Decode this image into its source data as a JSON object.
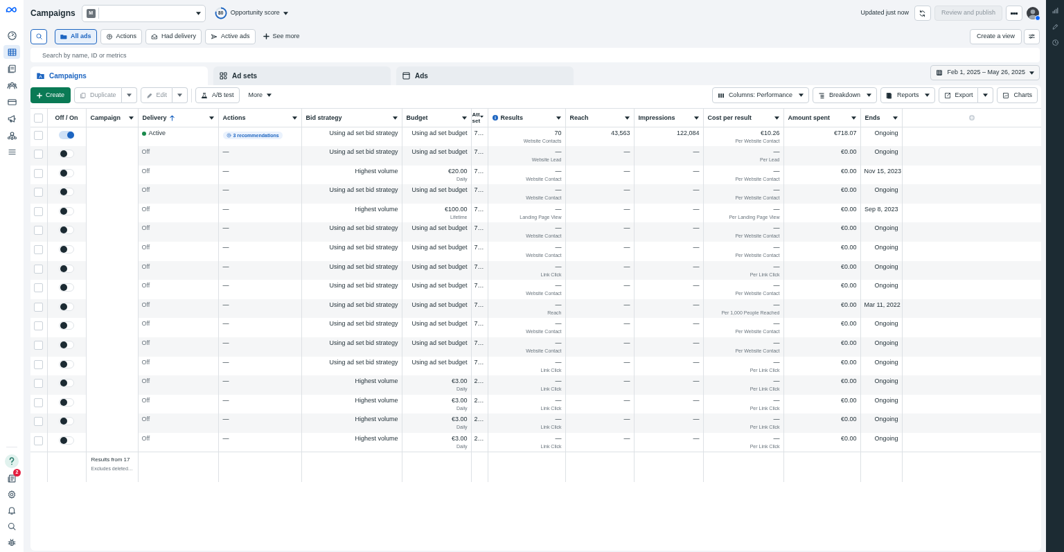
{
  "top_bar": {
    "title": "Campaigns",
    "account": {
      "initial": "M"
    },
    "opportunity": {
      "score": "80",
      "label": "Opportunity score"
    },
    "updated": "Updated just now",
    "publish_button": {
      "label": "Review and publish",
      "disabled": true
    }
  },
  "sidebar": {
    "items": [
      {
        "selected": false
      },
      {
        "selected": true
      },
      {
        "selected": false
      },
      {
        "selected": false
      },
      {
        "selected": false
      },
      {
        "selected": false
      },
      {
        "selected": false
      },
      {
        "selected": false
      }
    ],
    "notification_badge": "2"
  },
  "filters": [
    {
      "label": "All ads",
      "selected": true
    },
    {
      "label": "Actions",
      "selected": false
    },
    {
      "label": "Had delivery",
      "selected": false
    },
    {
      "label": "Active ads",
      "selected": false
    }
  ],
  "see_more": "See more",
  "create_view": "Create a view",
  "search": {
    "placeholder": "Search by name, ID or metrics"
  },
  "tabs": [
    {
      "label": "Campaigns",
      "selected": true
    },
    {
      "label": "Ad sets",
      "selected": false
    },
    {
      "label": "Ads",
      "selected": false
    }
  ],
  "date_range": "Feb 1, 2025 – May 26, 2025",
  "toolbar_left": [
    {
      "label": "Create",
      "kind": "primary",
      "disabled": false
    },
    {
      "label": "Duplicate",
      "kind": "split",
      "disabled": true
    },
    {
      "label": "Edit",
      "kind": "split",
      "disabled": true
    },
    {
      "label": "A/B test",
      "kind": "button",
      "disabled": false
    },
    {
      "label": "More",
      "kind": "plain-menu",
      "disabled": false
    }
  ],
  "toolbar_right": [
    {
      "label": "Columns: Performance",
      "kind": "menu",
      "disabled": false
    },
    {
      "label": "Breakdown",
      "kind": "menu",
      "disabled": false
    },
    {
      "label": "Reports",
      "kind": "menu",
      "disabled": false
    },
    {
      "label": "Export",
      "kind": "split",
      "disabled": false
    },
    {
      "label": "Charts",
      "kind": "button",
      "disabled": false
    }
  ],
  "table": {
    "select_all": {
      "checked": false
    },
    "columns": [
      {
        "label": "Off / On",
        "sorted": false,
        "info": false,
        "menu": false
      },
      {
        "label": "Campaign",
        "sorted": false,
        "info": false,
        "menu": true
      },
      {
        "label": "Delivery",
        "sorted": true,
        "info": false,
        "menu": true
      },
      {
        "label": "Actions",
        "sorted": false,
        "info": false,
        "menu": true
      },
      {
        "label": "Bid strategy",
        "sorted": false,
        "info": false,
        "menu": true
      },
      {
        "label": "Budget",
        "sorted": false,
        "info": false,
        "menu": true
      },
      {
        "label": "Att set",
        "sorted": false,
        "info": false,
        "menu": true
      },
      {
        "label": "Results",
        "sorted": false,
        "info": true,
        "menu": true
      },
      {
        "label": "Reach",
        "sorted": false,
        "info": false,
        "menu": true
      },
      {
        "label": "Impressions",
        "sorted": false,
        "info": false,
        "menu": true
      },
      {
        "label": "Cost per result",
        "sorted": false,
        "info": false,
        "menu": true
      },
      {
        "label": "Amount spent",
        "sorted": false,
        "info": false,
        "menu": true
      },
      {
        "label": "Ends",
        "sorted": false,
        "info": false,
        "menu": true
      }
    ],
    "rows": [
      {
        "selected": false,
        "on": true,
        "active": true,
        "delivery": "Active",
        "actions": {
          "kind": "chip",
          "text": "3 recommendations"
        },
        "bid_strategy": "Using ad set bid strategy",
        "budget": "Using ad set budget",
        "attribution": "7…",
        "results": "70",
        "results_type": "Website Contacts",
        "reach": "43,563",
        "impressions": "122,084",
        "cost_per_result": "€10.26",
        "cost_type": "Per Website Contact",
        "amount_spent": "€718.07",
        "ends": "Ongoing"
      },
      {
        "selected": false,
        "on": false,
        "active": false,
        "delivery": "Off",
        "actions": {
          "kind": "text",
          "text": "—"
        },
        "bid_strategy": "Using ad set bid strategy",
        "budget": "Using ad set budget",
        "attribution": "7…",
        "results": "—",
        "results_type": "Website Lead",
        "reach": "—",
        "impressions": "—",
        "cost_per_result": "—",
        "cost_type": "Per Lead",
        "amount_spent": "€0.00",
        "ends": "Ongoing"
      },
      {
        "selected": false,
        "on": false,
        "active": false,
        "delivery": "Off",
        "actions": {
          "kind": "text",
          "text": "—"
        },
        "bid_strategy": "Highest volume",
        "budget": "€20.00",
        "budget_period": "Daily",
        "attribution": "7…",
        "results": "—",
        "results_type": "Website Contact",
        "reach": "—",
        "impressions": "—",
        "cost_per_result": "—",
        "cost_type": "Per Website Contact",
        "amount_spent": "€0.00",
        "ends": "Nov 15, 2023"
      },
      {
        "selected": false,
        "on": false,
        "active": false,
        "delivery": "Off",
        "actions": {
          "kind": "text",
          "text": "—"
        },
        "bid_strategy": "Using ad set bid strategy",
        "budget": "Using ad set budget",
        "attribution": "7…",
        "results": "—",
        "results_type": "Website Contact",
        "reach": "—",
        "impressions": "—",
        "cost_per_result": "—",
        "cost_type": "Per Website Contact",
        "amount_spent": "€0.00",
        "ends": "Ongoing"
      },
      {
        "selected": false,
        "on": false,
        "active": false,
        "delivery": "Off",
        "actions": {
          "kind": "text",
          "text": "—"
        },
        "bid_strategy": "Highest volume",
        "budget": "€100.00",
        "budget_period": "Lifetime",
        "attribution": "7…",
        "results": "—",
        "results_type": "Landing Page View",
        "reach": "—",
        "impressions": "—",
        "cost_per_result": "—",
        "cost_type": "Per Landing Page View",
        "amount_spent": "€0.00",
        "ends": "Sep 8, 2023"
      },
      {
        "selected": false,
        "on": false,
        "active": false,
        "delivery": "Off",
        "actions": {
          "kind": "text",
          "text": "—"
        },
        "bid_strategy": "Using ad set bid strategy",
        "budget": "Using ad set budget",
        "attribution": "7…",
        "results": "—",
        "results_type": "Website Contact",
        "reach": "—",
        "impressions": "—",
        "cost_per_result": "—",
        "cost_type": "Per Website Contact",
        "amount_spent": "€0.00",
        "ends": "Ongoing"
      },
      {
        "selected": false,
        "on": false,
        "active": false,
        "delivery": "Off",
        "actions": {
          "kind": "text",
          "text": "—"
        },
        "bid_strategy": "Using ad set bid strategy",
        "budget": "Using ad set budget",
        "attribution": "7…",
        "results": "—",
        "results_type": "Website Contact",
        "reach": "—",
        "impressions": "—",
        "cost_per_result": "—",
        "cost_type": "Per Website Contact",
        "amount_spent": "€0.00",
        "ends": "Ongoing"
      },
      {
        "selected": false,
        "on": false,
        "active": false,
        "delivery": "Off",
        "actions": {
          "kind": "text",
          "text": "—"
        },
        "bid_strategy": "Using ad set bid strategy",
        "budget": "Using ad set budget",
        "attribution": "7…",
        "results": "—",
        "results_type": "Link Click",
        "reach": "—",
        "impressions": "—",
        "cost_per_result": "—",
        "cost_type": "Per Link Click",
        "amount_spent": "€0.00",
        "ends": "Ongoing"
      },
      {
        "selected": false,
        "on": false,
        "active": false,
        "delivery": "Off",
        "actions": {
          "kind": "text",
          "text": "—"
        },
        "bid_strategy": "Using ad set bid strategy",
        "budget": "Using ad set budget",
        "attribution": "7…",
        "results": "—",
        "results_type": "Website Contact",
        "reach": "—",
        "impressions": "—",
        "cost_per_result": "—",
        "cost_type": "Per Website Contact",
        "amount_spent": "€0.00",
        "ends": "Ongoing"
      },
      {
        "selected": false,
        "on": false,
        "active": false,
        "delivery": "Off",
        "actions": {
          "kind": "text",
          "text": "—"
        },
        "bid_strategy": "Using ad set bid strategy",
        "budget": "Using ad set budget",
        "attribution": "7…",
        "results": "—",
        "results_type": "Reach",
        "reach": "—",
        "impressions": "—",
        "cost_per_result": "—",
        "cost_type": "Per 1,000 People Reached",
        "amount_spent": "€0.00",
        "ends": "Mar 11, 2022"
      },
      {
        "selected": false,
        "on": false,
        "active": false,
        "delivery": "Off",
        "actions": {
          "kind": "text",
          "text": "—"
        },
        "bid_strategy": "Using ad set bid strategy",
        "budget": "Using ad set budget",
        "attribution": "7…",
        "results": "—",
        "results_type": "Website Contact",
        "reach": "—",
        "impressions": "—",
        "cost_per_result": "—",
        "cost_type": "Per Website Contact",
        "amount_spent": "€0.00",
        "ends": "Ongoing"
      },
      {
        "selected": false,
        "on": false,
        "active": false,
        "delivery": "Off",
        "actions": {
          "kind": "text",
          "text": "—"
        },
        "bid_strategy": "Using ad set bid strategy",
        "budget": "Using ad set budget",
        "attribution": "7…",
        "results": "—",
        "results_type": "Website Contact",
        "reach": "—",
        "impressions": "—",
        "cost_per_result": "—",
        "cost_type": "Per Website Contact",
        "amount_spent": "€0.00",
        "ends": "Ongoing"
      },
      {
        "selected": false,
        "on": false,
        "active": false,
        "delivery": "Off",
        "actions": {
          "kind": "text",
          "text": "—"
        },
        "bid_strategy": "Using ad set bid strategy",
        "budget": "Using ad set budget",
        "attribution": "7…",
        "results": "—",
        "results_type": "Link Click",
        "reach": "—",
        "impressions": "—",
        "cost_per_result": "—",
        "cost_type": "Per Link Click",
        "amount_spent": "€0.00",
        "ends": "Ongoing"
      },
      {
        "selected": false,
        "on": false,
        "active": false,
        "delivery": "Off",
        "actions": {
          "kind": "text",
          "text": "—"
        },
        "bid_strategy": "Highest volume",
        "budget": "€3.00",
        "budget_period": "Daily",
        "attribution": "2…",
        "results": "—",
        "results_type": "Link Click",
        "reach": "—",
        "impressions": "—",
        "cost_per_result": "—",
        "cost_type": "Per Link Click",
        "amount_spent": "€0.00",
        "ends": "Ongoing"
      },
      {
        "selected": false,
        "on": false,
        "active": false,
        "delivery": "Off",
        "actions": {
          "kind": "text",
          "text": "—"
        },
        "bid_strategy": "Highest volume",
        "budget": "€3.00",
        "budget_period": "Daily",
        "attribution": "2…",
        "results": "—",
        "results_type": "Link Click",
        "reach": "—",
        "impressions": "—",
        "cost_per_result": "—",
        "cost_type": "Per Link Click",
        "amount_spent": "€0.00",
        "ends": "Ongoing"
      },
      {
        "selected": false,
        "on": false,
        "active": false,
        "delivery": "Off",
        "actions": {
          "kind": "text",
          "text": "—"
        },
        "bid_strategy": "Highest volume",
        "budget": "€3.00",
        "budget_period": "Daily",
        "attribution": "2…",
        "results": "—",
        "results_type": "Link Click",
        "reach": "—",
        "impressions": "—",
        "cost_per_result": "—",
        "cost_type": "Per Link Click",
        "amount_spent": "€0.00",
        "ends": "Ongoing"
      },
      {
        "selected": false,
        "on": false,
        "active": false,
        "delivery": "Off",
        "actions": {
          "kind": "text",
          "text": "—"
        },
        "bid_strategy": "Highest volume",
        "budget": "€3.00",
        "budget_period": "Daily",
        "attribution": "2…",
        "results": "—",
        "results_type": "Link Click",
        "reach": "—",
        "impressions": "—",
        "cost_per_result": "—",
        "cost_type": "Per Link Click",
        "amount_spent": "€0.00",
        "ends": "Ongoing"
      }
    ],
    "footer": {
      "title": "Results from 17",
      "note": "Excludes deleted…"
    }
  }
}
